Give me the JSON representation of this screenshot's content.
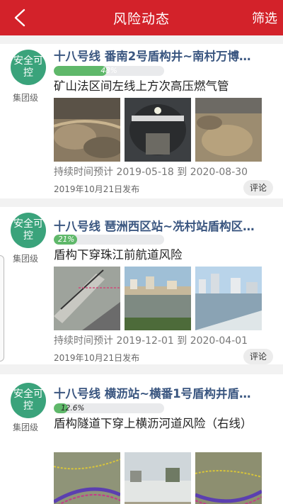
{
  "header": {
    "title": "风险动态",
    "filter_label": "筛选"
  },
  "colors": {
    "header_bg": "#d3222a",
    "badge_bg": "#3aa37b",
    "progress_fill": "#5fb86a",
    "line_title": "#3a5680"
  },
  "cards": [
    {
      "badge": "安全可控",
      "level": "集团级",
      "line": "十八号线 番南2号盾构井~南村万博…",
      "progress": 0.48,
      "progress_label": "48%",
      "risk": "矿山法区间左线上方次高压燃气管",
      "period": "持续时间预计 2019-05-18 到 2020-08-30",
      "published": "2019年10月21日发布",
      "comment": "评论"
    },
    {
      "badge": "安全可控",
      "level": "集团级",
      "line": "十八号线 琶洲西区站~冼村站盾构区…",
      "progress": 0.21,
      "progress_label": "21%",
      "risk": "盾构下穿珠江前航道风险",
      "period": "持续时间预计 2019-12-01 到 2020-04-01",
      "published": "2019年10月21日发布",
      "comment": "评论"
    },
    {
      "badge": "安全可控",
      "level": "集团级",
      "line": "十八号线 横沥站~横番1号盾构井盾…",
      "progress": 0.126,
      "progress_label": "12.6%",
      "risk": "盾构隧道下穿上横沥河道风险（右线）"
    }
  ]
}
